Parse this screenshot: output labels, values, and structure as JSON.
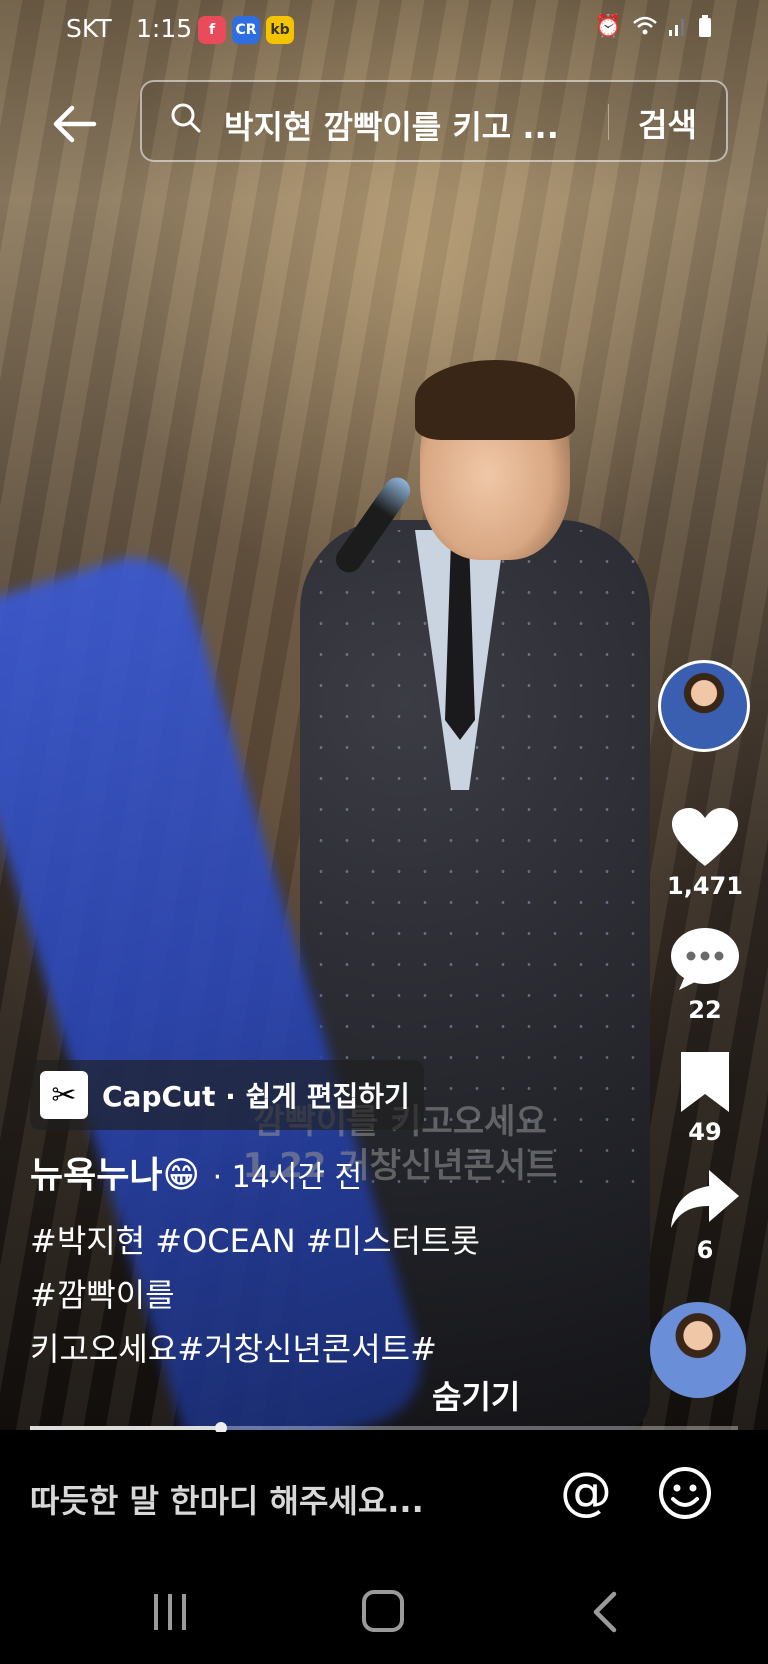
{
  "status_bar": {
    "carrier": "SKT",
    "time": "1:15",
    "badges": [
      "f",
      "CR",
      "kb"
    ]
  },
  "search": {
    "back_icon": "arrow-left-icon",
    "query": "박지현 깜빡이를 키고 ...",
    "button_label": "검색"
  },
  "video": {
    "watermark_line1": "깜빡이를 키고오세요",
    "watermark_line2": "1.22 거창신년콘서트"
  },
  "rail": {
    "likes": "1,471",
    "comments": "22",
    "saves": "49",
    "shares": "6"
  },
  "capcut": {
    "label": "CapCut · 쉽게 편집하기"
  },
  "post": {
    "author": "뉴욕누나😁",
    "time": "· 14시간 전",
    "caption_lines": [
      "#박지현 #OCEAN #미스터트롯",
      "#깜빡이를",
      "키고오세요#거창신년콘서트#"
    ],
    "hide_label": "숨기기"
  },
  "progress": {
    "fraction": 0.27
  },
  "comment": {
    "placeholder": "따듯한 말 한마디 해주세요...",
    "at_label": "@"
  }
}
